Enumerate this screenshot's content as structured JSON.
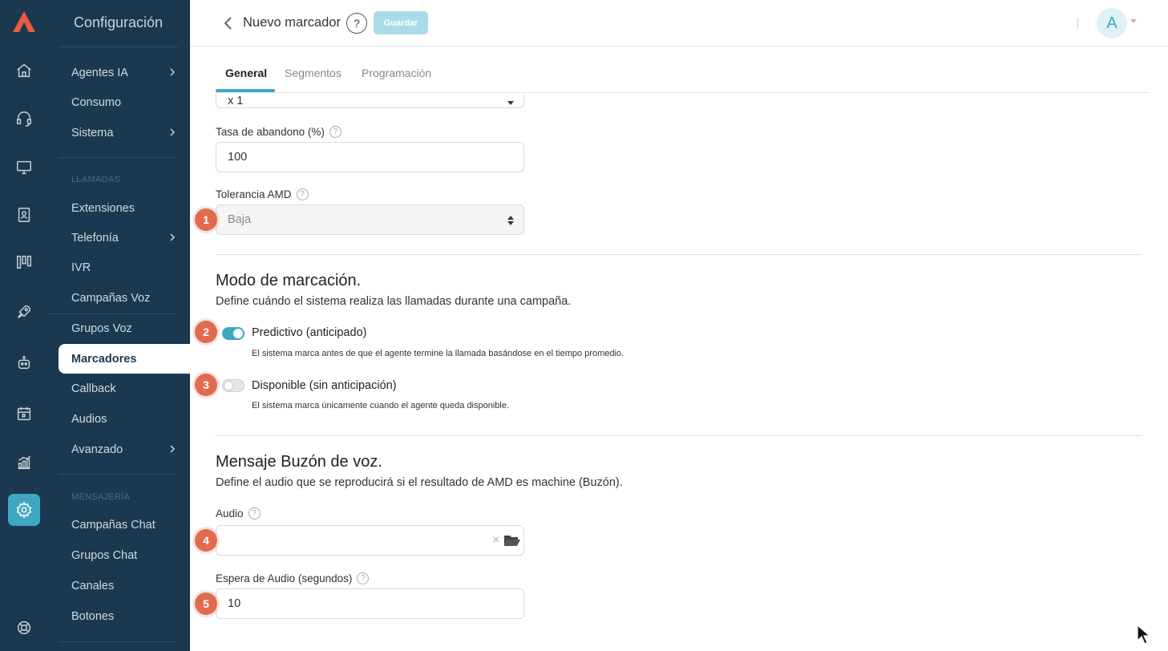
{
  "sidebar": {
    "title": "Configuración",
    "items": [
      {
        "label": "Agentes IA",
        "chevron": true
      },
      {
        "label": "Consumo",
        "chevron": false
      },
      {
        "label": "Sistema",
        "chevron": true
      }
    ],
    "section_llamadas": "LLAMADAS",
    "llamadas_items": [
      {
        "label": "Extensiones"
      },
      {
        "label": "Telefonía",
        "chevron": true
      },
      {
        "label": "IVR"
      },
      {
        "label": "Campañas Voz"
      },
      {
        "label": "Grupos Voz"
      },
      {
        "label": "Marcadores",
        "active": true
      },
      {
        "label": "Callback"
      },
      {
        "label": "Audios"
      },
      {
        "label": "Avanzado",
        "chevron": true
      }
    ],
    "section_mensajeria": "MENSAJERÍA",
    "mensajeria_items": [
      {
        "label": "Campañas Chat"
      },
      {
        "label": "Grupos Chat"
      },
      {
        "label": "Canales"
      },
      {
        "label": "Botones"
      }
    ]
  },
  "rail_icons": [
    "home-icon",
    "headset-icon",
    "monitor-icon",
    "contacts-icon",
    "board-icon",
    "rocket-icon",
    "robot-icon",
    "calendar-icon",
    "reports-icon",
    "settings-icon",
    "support-icon"
  ],
  "header": {
    "title": "Nuevo marcador",
    "help": "?",
    "save_label": "Guardar",
    "avatar_initial": "A"
  },
  "tabs": [
    {
      "label": "General",
      "active": true
    },
    {
      "label": "Segmentos"
    },
    {
      "label": "Programación"
    }
  ],
  "form": {
    "partial_select_value": "x 1",
    "abandon_rate_label": "Tasa de abandono (%)",
    "abandon_rate_value": "100",
    "amd_tolerance_label": "Tolerancia AMD",
    "amd_tolerance_value": "Baja",
    "dial_mode": {
      "title": "Modo de marcación.",
      "description": "Define cuándo el sistema realiza las llamadas durante una campaña.",
      "options": [
        {
          "title": "Predictivo (anticipado)",
          "description": "El sistema marca antes de que el agente termine la llamada basándose en el tiempo promedio.",
          "enabled": true
        },
        {
          "title": "Disponible (sin anticipación)",
          "description": "El sistema marca únicamente cuando el agente queda disponible.",
          "enabled": false
        }
      ]
    },
    "voicemail": {
      "title": "Mensaje Buzón de voz.",
      "description": "Define el audio que se reproducirá si el resultado de AMD es machine (Buzón).",
      "audio_label": "Audio",
      "audio_value": "",
      "audio_clear": "×",
      "wait_label": "Espera de Audio (segundos)",
      "wait_value": "10"
    }
  },
  "markers": [
    "1",
    "2",
    "3",
    "4",
    "5"
  ],
  "colors": {
    "sidebar_bg": "#1a3950",
    "accent": "#3fa7c1",
    "marker": "#e06b4f",
    "save_button": "#a9dbe8"
  }
}
